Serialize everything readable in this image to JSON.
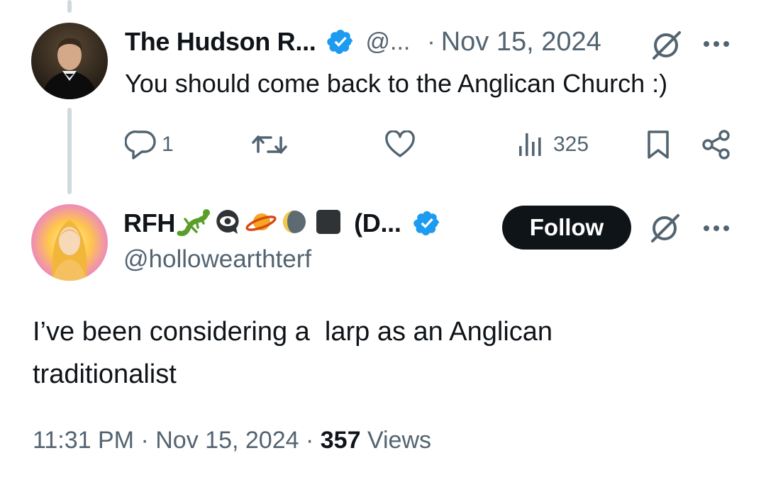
{
  "colors": {
    "accent": "#1d9bf0",
    "text": "#0f1419",
    "secondary": "#536471",
    "thread": "#cfd9de"
  },
  "parent_tweet": {
    "author_name": "The Hudson R...",
    "handle": "@...",
    "separator": "·",
    "date": "Nov 15, 2024",
    "text": "You should come back to the Anglican Church :)",
    "reply_count": "1",
    "views": "325",
    "icons": [
      "verified-badge-icon",
      "grok-icon",
      "more-icon",
      "reply-icon",
      "retweet-icon",
      "like-icon",
      "views-icon",
      "bookmark-icon",
      "share-icon"
    ]
  },
  "main_tweet": {
    "author_name": "RFH",
    "author_name_suffix": "(D...",
    "name_emojis": [
      "lizard",
      "eye-in-speech-bubble",
      "ringed-planet",
      "moon",
      "black-square"
    ],
    "handle": "@hollowearthterf",
    "follow_label": "Follow",
    "text_line1": "I’ve been considering a  larp as an Anglican",
    "text_line2": "traditionalist",
    "time": "11:31 PM",
    "dot": "·",
    "date": "Nov 15, 2024",
    "views_count": "357",
    "views_label": "Views"
  }
}
